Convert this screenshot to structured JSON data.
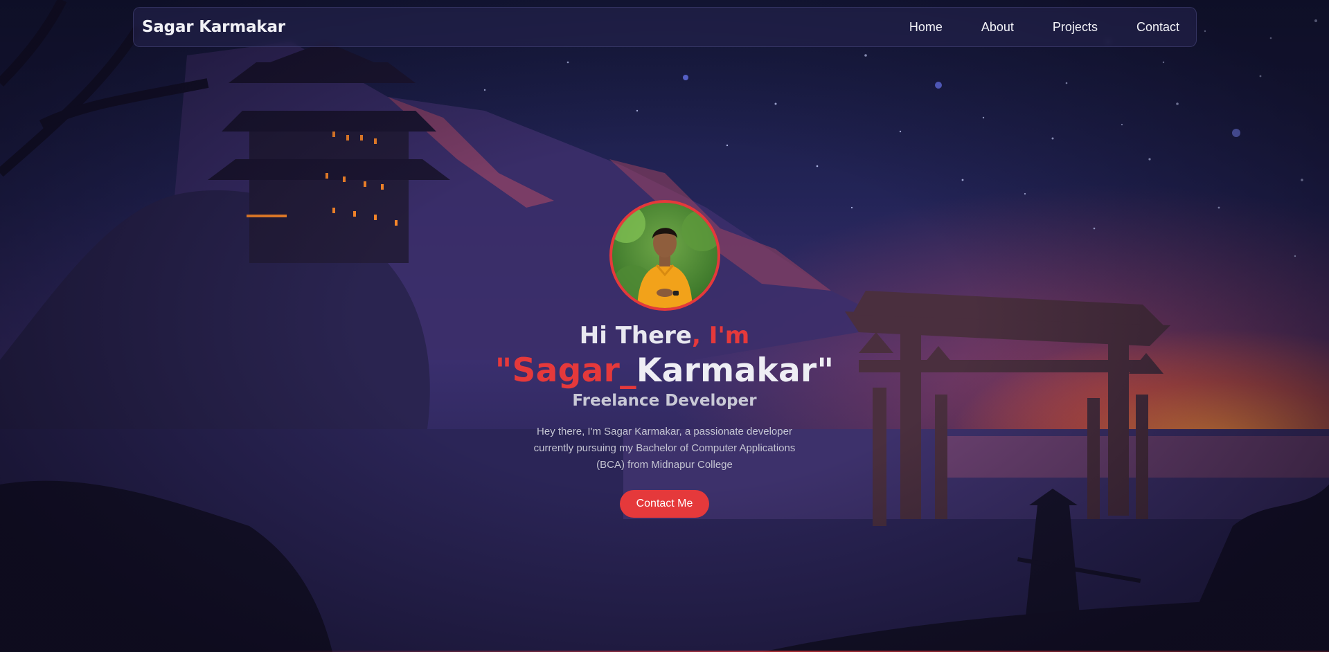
{
  "brand": "Sagar Karmakar",
  "nav": {
    "items": [
      {
        "label": "Home"
      },
      {
        "label": "About"
      },
      {
        "label": "Projects"
      },
      {
        "label": "Contact"
      }
    ]
  },
  "hero": {
    "greeting_main": "Hi There",
    "greeting_accent": ", I'm",
    "name_accent": "\"Sagar_",
    "name_main": "Karmakar\"",
    "role": "Freelance Developer",
    "bio": "Hey there, I'm Sagar Karmakar, a passionate developer currently pursuing my Bachelor of Computer Applications (BCA) from Midnapur College",
    "cta_label": "Contact Me"
  },
  "colors": {
    "accent": "#e5393b",
    "background": "#232457",
    "text": "#eeeef4"
  },
  "icons": {
    "avatar": "profile-photo"
  }
}
